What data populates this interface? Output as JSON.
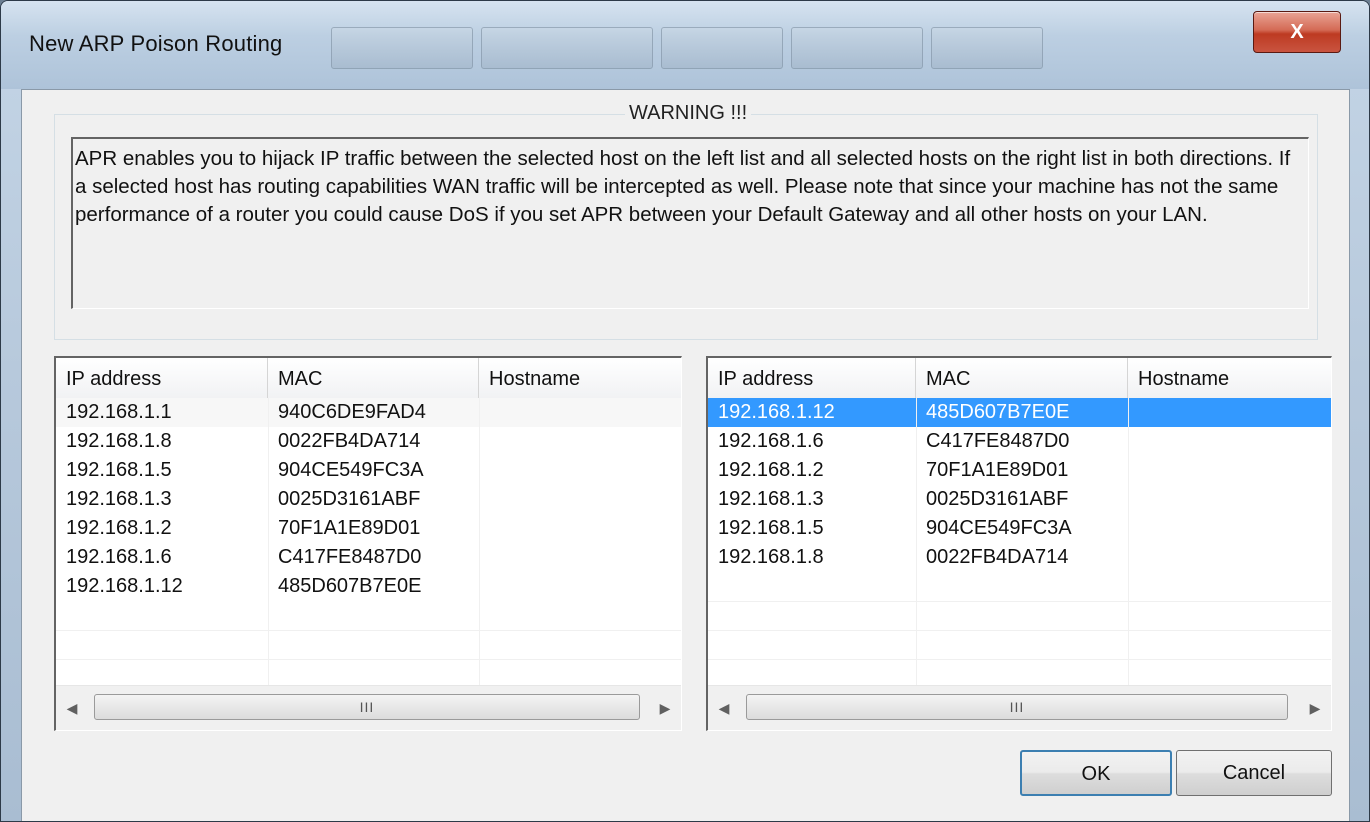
{
  "window": {
    "title": "New ARP Poison Routing",
    "close_label": "X"
  },
  "warning": {
    "legend": "WARNING !!!",
    "text": "APR enables you to hijack IP traffic between the selected host on the left list and all selected hosts on the right list in both directions. If a selected host has routing capabilities WAN traffic will be intercepted as well. Please note that since your machine has not the same performance of a router you could cause DoS if you set APR between your Default Gateway and all other hosts on your LAN."
  },
  "left_list": {
    "columns": [
      "IP address",
      "MAC",
      "Hostname"
    ],
    "rows": [
      {
        "ip": "192.168.1.1",
        "mac": "940C6DE9FAD4",
        "hostname": ""
      },
      {
        "ip": "192.168.1.8",
        "mac": "0022FB4DA714",
        "hostname": ""
      },
      {
        "ip": "192.168.1.5",
        "mac": "904CE549FC3A",
        "hostname": ""
      },
      {
        "ip": "192.168.1.3",
        "mac": "0025D3161ABF",
        "hostname": ""
      },
      {
        "ip": "192.168.1.2",
        "mac": "70F1A1E89D01",
        "hostname": ""
      },
      {
        "ip": "192.168.1.6",
        "mac": "C417FE8487D0",
        "hostname": ""
      },
      {
        "ip": "192.168.1.12",
        "mac": "485D607B7E0E",
        "hostname": ""
      }
    ],
    "selected_index": 0
  },
  "right_list": {
    "columns": [
      "IP address",
      "MAC",
      "Hostname"
    ],
    "rows": [
      {
        "ip": "192.168.1.12",
        "mac": "485D607B7E0E",
        "hostname": ""
      },
      {
        "ip": "192.168.1.6",
        "mac": "C417FE8487D0",
        "hostname": ""
      },
      {
        "ip": "192.168.1.2",
        "mac": "70F1A1E89D01",
        "hostname": ""
      },
      {
        "ip": "192.168.1.3",
        "mac": "0025D3161ABF",
        "hostname": ""
      },
      {
        "ip": "192.168.1.5",
        "mac": "904CE549FC3A",
        "hostname": ""
      },
      {
        "ip": "192.168.1.8",
        "mac": "0022FB4DA714",
        "hostname": ""
      }
    ],
    "selected_index": 0
  },
  "scrollbar": {
    "left_arrow": "◀",
    "right_arrow": "▶",
    "grip": "III"
  },
  "buttons": {
    "ok": "OK",
    "cancel": "Cancel"
  },
  "colors": {
    "selection": "#3399ff",
    "close_button": "#c9432c",
    "dialog_face": "#f0f0f0"
  }
}
